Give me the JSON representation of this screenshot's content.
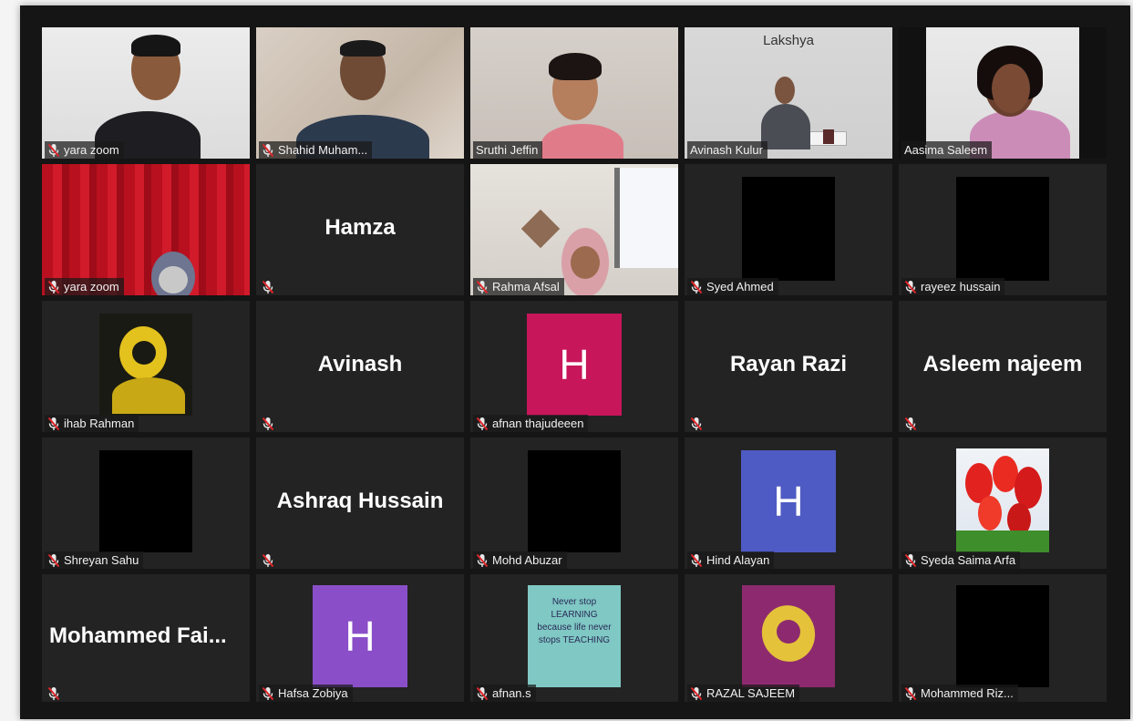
{
  "participants": [
    {
      "name": "yara zoom",
      "muted": true
    },
    {
      "name": "Shahid Muham...",
      "muted": true
    },
    {
      "name": "Sruthi Jeffin",
      "muted": false,
      "active_speaker": true
    },
    {
      "name": "Avinash Kulur",
      "muted": false,
      "background_text": "Lakshya"
    },
    {
      "name": "Aasima Saleem",
      "muted": false
    },
    {
      "name": "yara zoom",
      "muted": true
    },
    {
      "name": "",
      "display_name": "Hamza",
      "muted": true
    },
    {
      "name": "Rahma Afsal",
      "muted": true
    },
    {
      "name": "Syed Ahmed",
      "muted": true
    },
    {
      "name": "rayeez hussain",
      "muted": true
    },
    {
      "name": "ihab Rahman",
      "muted": true
    },
    {
      "name": "",
      "display_name": "Avinash",
      "muted": true
    },
    {
      "name": "afnan thajudeeen",
      "muted": true,
      "avatar_letter": "H",
      "avatar_color": "#c8165a"
    },
    {
      "name": "",
      "display_name": "Rayan Razi",
      "muted": true
    },
    {
      "name": "",
      "display_name": "Asleem najeem",
      "muted": true
    },
    {
      "name": "Shreyan Sahu",
      "muted": true
    },
    {
      "name": "",
      "display_name": "Ashraq Hussain",
      "muted": true
    },
    {
      "name": "Mohd Abuzar",
      "muted": true
    },
    {
      "name": "Hind Alayan",
      "muted": true,
      "avatar_letter": "H",
      "avatar_color": "#4f5bc4"
    },
    {
      "name": "Syeda Saima Arfa",
      "muted": true
    },
    {
      "name": "",
      "display_name": "Mohammed Fai...",
      "muted": true
    },
    {
      "name": "Hafsa Zobiya",
      "muted": true,
      "avatar_letter": "H",
      "avatar_color": "#8a4fc8"
    },
    {
      "name": "afnan.s",
      "muted": true,
      "avatar_text": "Never stop LEARNING because life never stops TEACHING"
    },
    {
      "name": "RAZAL SAJEEM",
      "muted": true
    },
    {
      "name": "Mohammed Riz...",
      "muted": true
    }
  ],
  "colors": {
    "active_outline": "#c3d86a",
    "muted_icon": "#e0262b",
    "tile_bg": "#232323"
  },
  "icons": {
    "muted": "mic-muted-icon"
  }
}
